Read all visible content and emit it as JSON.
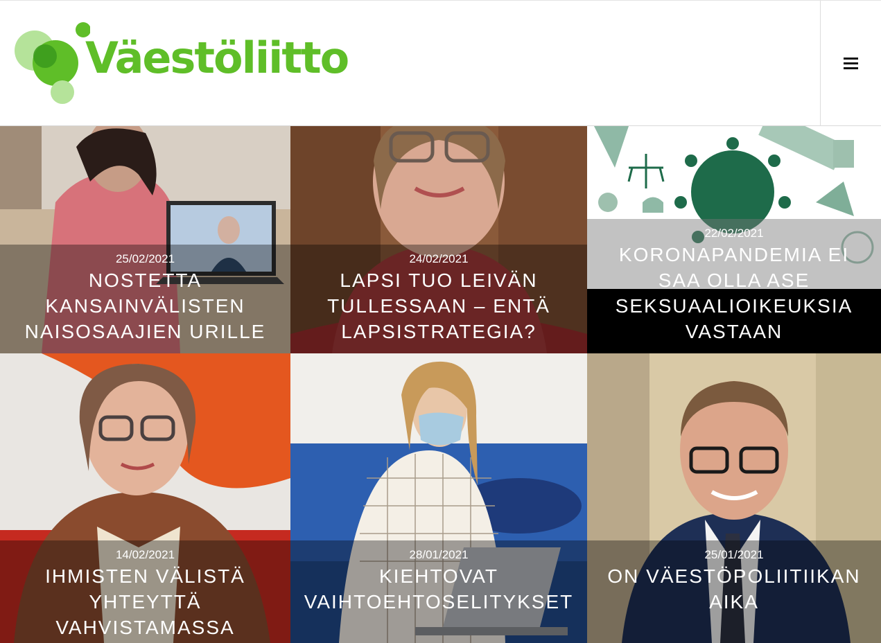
{
  "header": {
    "logo_text": "Väestöliitto",
    "colors": {
      "brand_green": "#5fbe28",
      "brand_dark_green": "#3a9a1c",
      "brand_light_green": "#b5e39a"
    },
    "menu_icon": "hamburger-icon"
  },
  "articles": [
    {
      "date": "25/02/2021",
      "title": "NOSTETTA KANSAINVÄLISTEN NAISOSAAJIEN URILLE"
    },
    {
      "date": "24/02/2021",
      "title": "LAPSI TUO LEIVÄN TULLESSAAN – ENTÄ LAPSISTRATEGIA?"
    },
    {
      "date": "22/02/2021",
      "title": "KORONAPANDEMIA EI SAA OLLA ASE SEKSUAALIOIKEUKSIA VASTAAN"
    },
    {
      "date": "14/02/2021",
      "title": "IHMISTEN VÄLISTÄ YHTEYTTÄ VAHVISTAMASSA"
    },
    {
      "date": "28/01/2021",
      "title": "KIEHTOVAT VAIHTOEHTOSELITYKSET"
    },
    {
      "date": "25/01/2021",
      "title": "ON VÄESTÖPOLIITIIKAN AIKA"
    }
  ]
}
